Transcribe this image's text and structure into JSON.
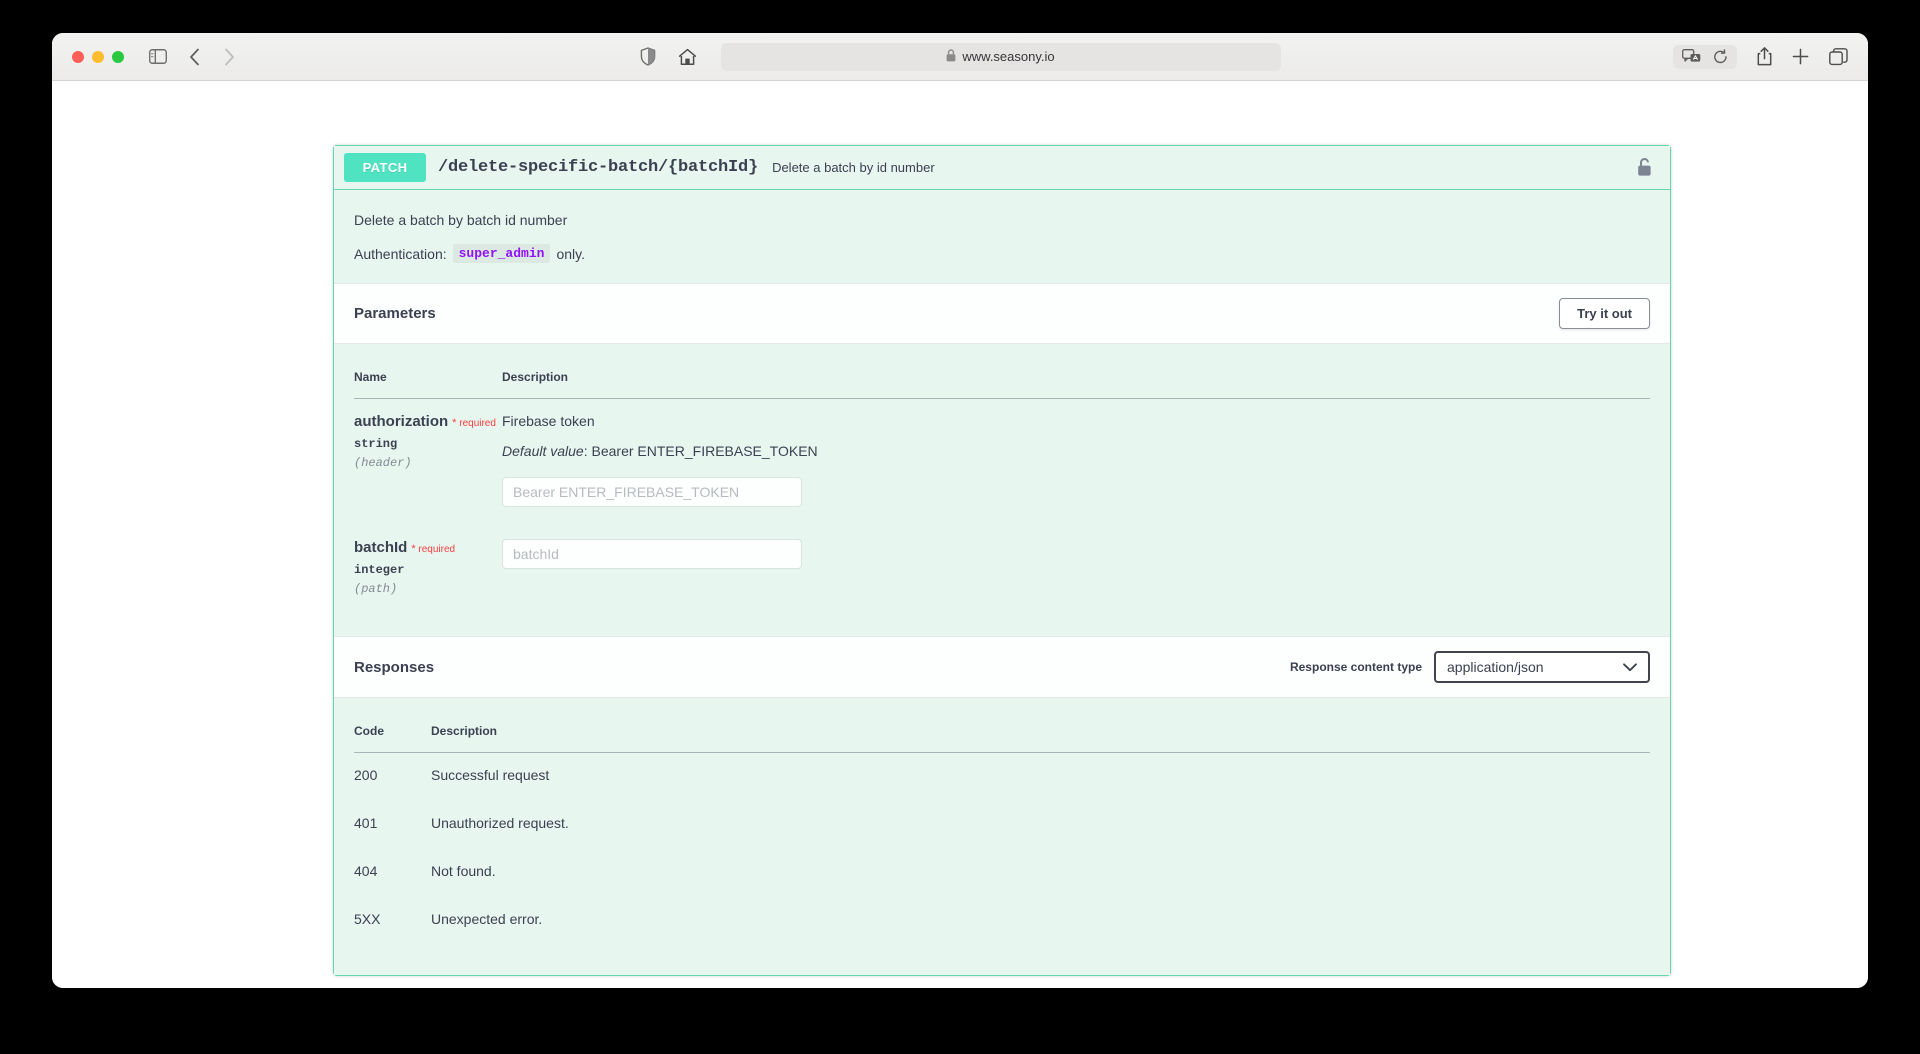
{
  "browser": {
    "url": "www.seasony.io",
    "icons": {
      "sidebar": "sidebar-toggle-icon",
      "back": "back-arrow-icon",
      "forward": "forward-arrow-icon",
      "shield": "shield-privacy-icon",
      "home": "home-icon",
      "lock": "lock-icon",
      "translate": "translate-icon",
      "reload": "reload-icon",
      "share": "share-icon",
      "new_tab": "plus-icon",
      "tab_overview": "tab-overview-icon"
    }
  },
  "operation": {
    "method": "PATCH",
    "path": "/delete-specific-batch/{batchId}",
    "summary": "Delete a batch by id number",
    "lock_icon": "unlocked-padlock-icon",
    "description": "Delete a batch by batch id number",
    "auth_prefix": "Authentication:",
    "auth_role": "super_admin",
    "auth_suffix": "only."
  },
  "parameters_section": {
    "title": "Parameters",
    "try_it_out_label": "Try it out",
    "columns": {
      "name": "Name",
      "description": "Description"
    },
    "required_label": "required",
    "required_star": "*",
    "rows": [
      {
        "name": "authorization",
        "required": true,
        "type": "string",
        "in": "(header)",
        "description": "Firebase token",
        "default_label": "Default value",
        "default_value": ": Bearer ENTER_FIREBASE_TOKEN",
        "input_placeholder": "Bearer ENTER_FIREBASE_TOKEN",
        "input_value": ""
      },
      {
        "name": "batchId",
        "required": true,
        "type": "integer",
        "in": "(path)",
        "description": "",
        "default_label": "",
        "default_value": "",
        "input_placeholder": "batchId",
        "input_value": ""
      }
    ]
  },
  "responses_section": {
    "title": "Responses",
    "content_type_label": "Response content type",
    "content_type_value": "application/json",
    "content_type_options": [
      "application/json"
    ],
    "columns": {
      "code": "Code",
      "description": "Description"
    },
    "rows": [
      {
        "code": "200",
        "description": "Successful request"
      },
      {
        "code": "401",
        "description": "Unauthorized request."
      },
      {
        "code": "404",
        "description": "Not found."
      },
      {
        "code": "5XX",
        "description": "Unexpected error."
      }
    ]
  },
  "colors": {
    "method_badge": "#50e3c2",
    "panel_border": "#64d6b0",
    "panel_bg": "#e8f6f0",
    "required_red": "#f93e3e",
    "code_purple": "#9012fe",
    "text": "#3b4151"
  }
}
